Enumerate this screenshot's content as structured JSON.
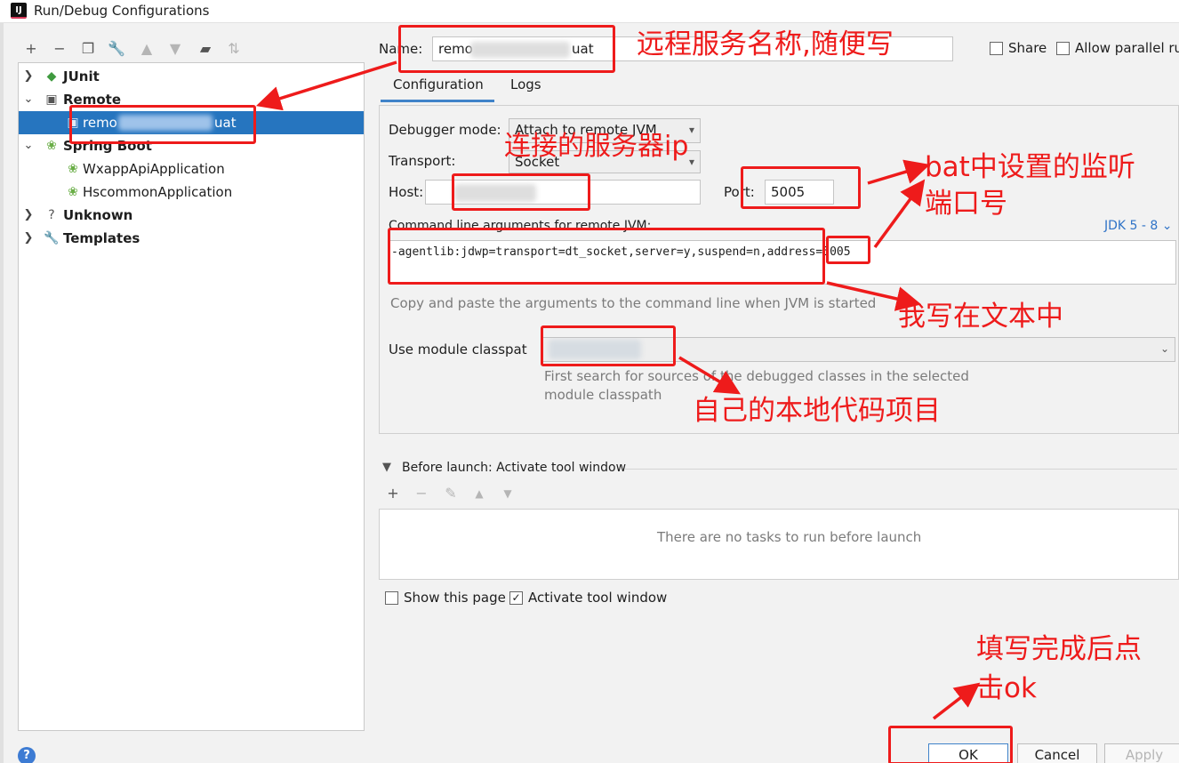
{
  "window": {
    "title": "Run/Debug Configurations",
    "app_icon": "IJ"
  },
  "toolbar": [
    {
      "name": "add-icon",
      "glyph": "+",
      "dim": false
    },
    {
      "name": "remove-icon",
      "glyph": "−",
      "dim": false
    },
    {
      "name": "copy-icon",
      "glyph": "❐",
      "dim": false
    },
    {
      "name": "wrench-icon",
      "glyph": "🔧",
      "dim": false
    },
    {
      "name": "move-up-icon",
      "glyph": "▲",
      "dim": true
    },
    {
      "name": "move-down-icon",
      "glyph": "▼",
      "dim": true
    },
    {
      "name": "folder-icon",
      "glyph": "▰",
      "dim": false
    },
    {
      "name": "sort-icon",
      "glyph": "⇅",
      "dim": true
    }
  ],
  "tree": {
    "junit": "JUnit",
    "remote": "Remote",
    "remote_child_prefix": "remo",
    "remote_child_suffix": "uat",
    "springboot": "Spring Boot",
    "wxapp": "WxappApiApplication",
    "hscommon": "HscommonApplication",
    "unknown": "Unknown",
    "templates": "Templates"
  },
  "name_row": {
    "label": "Name:",
    "value_prefix": "remo",
    "value_suffix": "uat",
    "share": "Share",
    "allow_parallel": "Allow parallel ru"
  },
  "tabs": {
    "configuration": "Configuration",
    "logs": "Logs"
  },
  "config": {
    "debugger_mode_label": "Debugger mode:",
    "debugger_mode_value": "Attach to remote JVM",
    "transport_label": "Transport:",
    "transport_value": "Socket",
    "host_label": "Host:",
    "port_label": "Port:",
    "port_value": "5005",
    "cmd_label": "Command line arguments for remote JVM:",
    "jdk_selector": "JDK 5 - 8",
    "cmd_value": "-agentlib:jdwp=transport=dt_socket,server=y,suspend=n,address=5005",
    "cmd_hint": "Copy and paste the arguments to the command line when JVM is started",
    "module_label": "Use module classpat",
    "module_hint_line1": "First search for sources of the debugged classes in the selected",
    "module_hint_line2": "module classpath"
  },
  "before_launch": {
    "header": "Before launch: Activate tool window",
    "empty_text": "There are no tasks to run before launch",
    "show_page": "Show this page",
    "activate_tool": "Activate tool window"
  },
  "buttons": {
    "ok": "OK",
    "cancel": "Cancel",
    "apply": "Apply",
    "help": "?"
  },
  "annotations": {
    "name_note": "远程服务名称,随便写",
    "host_note": "连接的服务器ip",
    "port_note_1": "bat中设置的监听",
    "port_note_2": "端口号",
    "cmd_note": "我写在文本中",
    "module_note": "自己的本地代码项目",
    "ok_note_1": "填写完成后点",
    "ok_note_2": "击ok"
  },
  "colors": {
    "annotation_red": "#ee1b1b",
    "selection_blue": "#2675bf",
    "link_blue": "#2f73c7"
  }
}
